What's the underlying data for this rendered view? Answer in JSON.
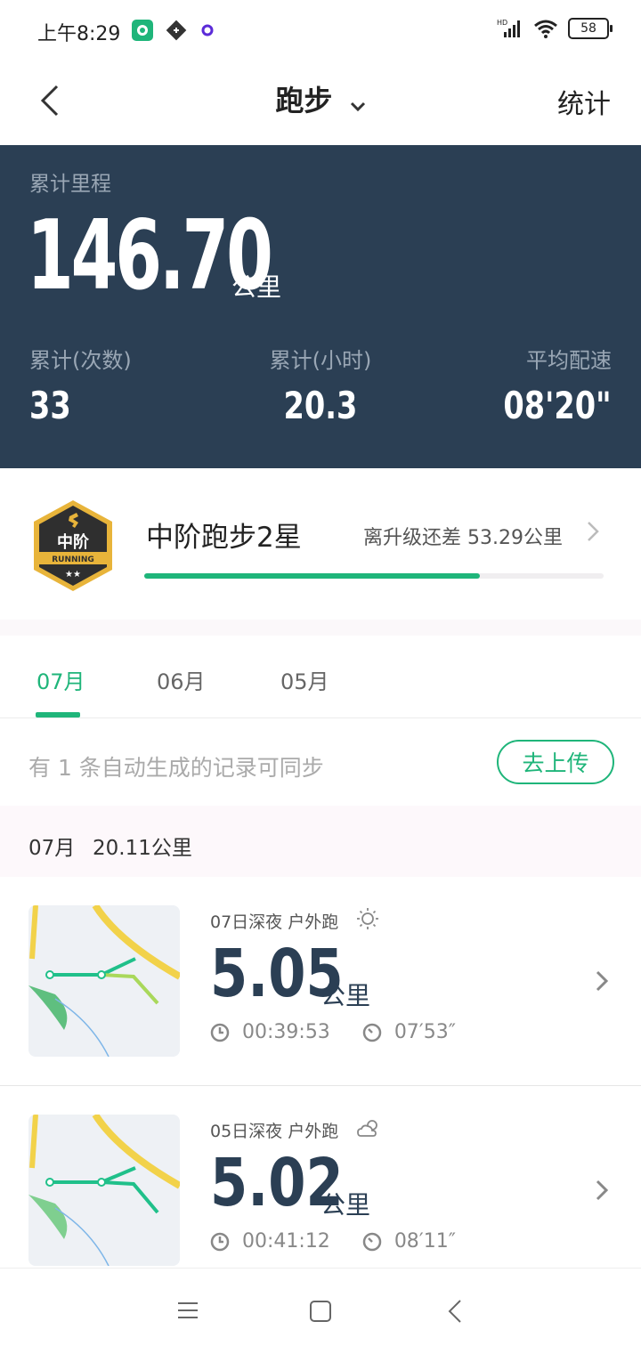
{
  "status_bar": {
    "time": "上午8:29",
    "battery": "58"
  },
  "header": {
    "title": "跑步",
    "right_link": "统计"
  },
  "summary": {
    "total_label": "累计里程",
    "total_value": "146.70",
    "total_unit": "公里",
    "stats": [
      {
        "label": "累计(次数)",
        "value": "33"
      },
      {
        "label": "累计(小时)",
        "value": "20.3"
      },
      {
        "label": "平均配速",
        "value": "08'20\""
      }
    ]
  },
  "level": {
    "badge_text": "中阶",
    "badge_sub": "RUNNING",
    "name": "中阶跑步2星",
    "remaining": "离升级还差 53.29公里",
    "progress_fraction": 0.73
  },
  "tabs": [
    {
      "label": "07月",
      "active": true
    },
    {
      "label": "06月",
      "active": false
    },
    {
      "label": "05月",
      "active": false
    }
  ],
  "sync": {
    "text": "有 1 条自动生成的记录可同步",
    "button": "去上传"
  },
  "month": {
    "label": "07月",
    "distance": "20.11公里"
  },
  "records": [
    {
      "info": "07日深夜 户外跑",
      "weather_icon": "sunny-icon",
      "distance": "5.05",
      "unit": "公里",
      "duration": "00:39:53",
      "pace": "07′53″"
    },
    {
      "info": "05日深夜 户外跑",
      "weather_icon": "cloudy-icon",
      "distance": "5.02",
      "unit": "公里",
      "duration": "00:41:12",
      "pace": "08′11″"
    }
  ],
  "colors": {
    "accent": "#1fb57a",
    "panel": "#2b3f54"
  }
}
